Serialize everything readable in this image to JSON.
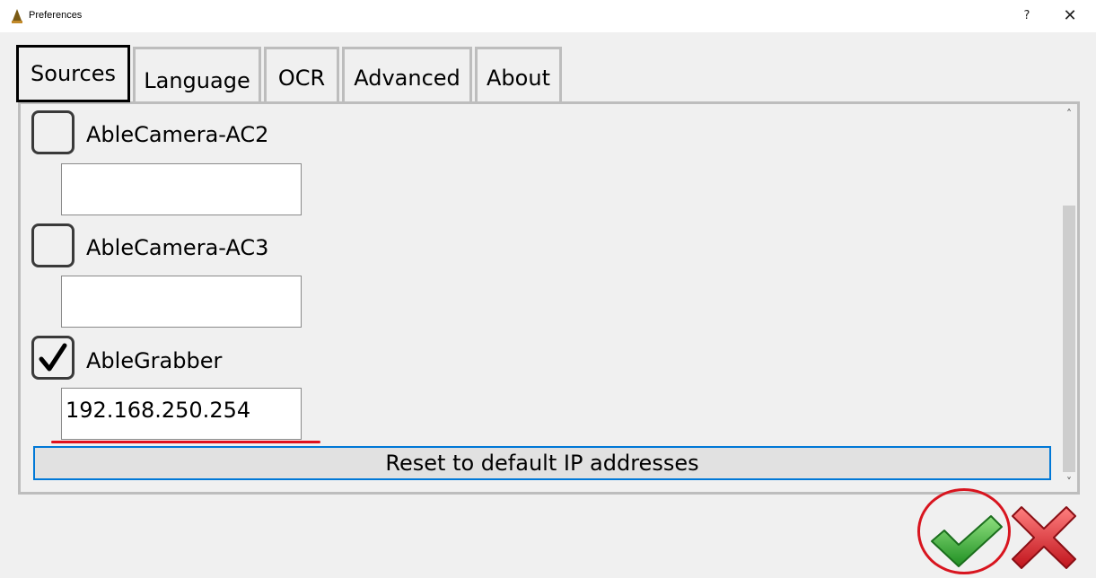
{
  "window": {
    "title": "Preferences",
    "help_label": "?",
    "close_label": "✕"
  },
  "tabs": [
    {
      "label": "Sources",
      "active": true
    },
    {
      "label": "Language",
      "active": false
    },
    {
      "label": "OCR",
      "active": false
    },
    {
      "label": "Advanced",
      "active": false
    },
    {
      "label": "About",
      "active": false
    }
  ],
  "sources": [
    {
      "label": "AbleCamera-AC2",
      "checked": false,
      "ip": ""
    },
    {
      "label": "AbleCamera-AC3",
      "checked": false,
      "ip": ""
    },
    {
      "label": "AbleGrabber",
      "checked": true,
      "ip": "192.168.250.254"
    }
  ],
  "scrollbar": {
    "up_icon": "˄",
    "down_icon": "˅"
  },
  "reset_button_label": "Reset to default IP addresses",
  "buttons": {
    "ok": "ok-check-icon",
    "cancel": "cancel-x-icon"
  },
  "colors": {
    "accent": "#0078d7",
    "annotation": "#e0101e",
    "ok_green": "#3fb53a",
    "cancel_red": "#e32530"
  }
}
